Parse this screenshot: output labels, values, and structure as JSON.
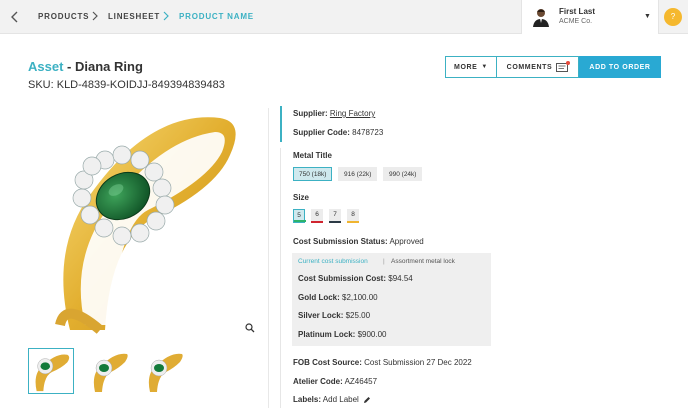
{
  "breadcrumb": {
    "items": [
      "PRODUCTS",
      "LINESHEET",
      "PRODUCT NAME"
    ]
  },
  "user": {
    "name": "First Last",
    "company": "ACME Co.",
    "notification_label": "?"
  },
  "product": {
    "type_label": "Asset",
    "title_separator": " - ",
    "name": "Diana Ring",
    "sku": "SKU: KLD-4839-KOIDJJ-849394839483"
  },
  "actions": {
    "more_label": "MORE",
    "comments_label": "COMMENTS",
    "add_to_order_label": "ADD TO ORDER"
  },
  "details": {
    "supplier_label": "Supplier:",
    "supplier_value": "Ring Factory",
    "supplier_code_label": "Supplier Code:",
    "supplier_code_value": "8478723",
    "metal_title_label": "Metal Title",
    "metal_options": [
      {
        "label": "750 (18k)",
        "selected": true
      },
      {
        "label": "916 (22k)",
        "selected": false
      },
      {
        "label": "990 (24k)",
        "selected": false
      }
    ],
    "size_label": "Size",
    "sizes": [
      {
        "label": "5",
        "color": "#2db36b",
        "selected": true
      },
      {
        "label": "6",
        "color": "#d0242f",
        "selected": false
      },
      {
        "label": "7",
        "color": "#2c3a45",
        "selected": false
      },
      {
        "label": "8",
        "color": "#f0b530",
        "selected": false
      }
    ],
    "cost_status_label": "Cost Submission Status:",
    "cost_status_value": "Approved",
    "cost_tabs": {
      "active": "Current cost submission",
      "separator": "|",
      "inactive": "Assortment metal lock"
    },
    "cost_lines": [
      {
        "label": "Cost Submission Cost:",
        "value": "$94.54"
      },
      {
        "label": "Gold Lock:",
        "value": "$2,100.00"
      },
      {
        "label": "Silver Lock:",
        "value": "$25.00"
      },
      {
        "label": "Platinum Lock:",
        "value": "$900.00"
      }
    ],
    "fob_label": "FOB Cost Source:",
    "fob_value": "Cost Submission 27 Dec 2022",
    "atelier_label": "Atelier Code:",
    "atelier_value": "AZ46457",
    "labels_label": "Labels:",
    "labels_value": "Add Label"
  },
  "colors": {
    "accent": "#3cb1c3",
    "primary_button": "#29a9d3",
    "gold": "#e8b93a",
    "emerald": "#137a3a"
  }
}
